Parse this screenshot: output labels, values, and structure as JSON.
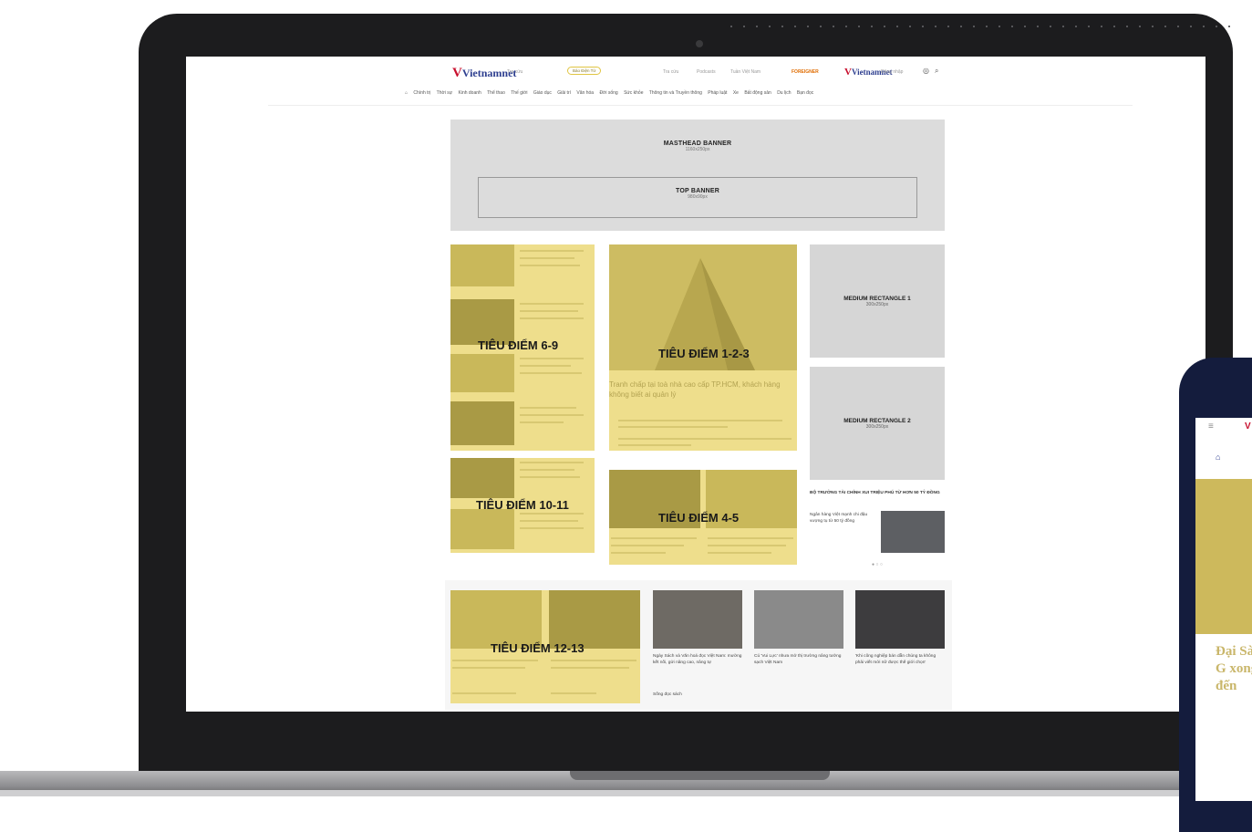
{
  "header": {
    "logo": "Vietnamnet",
    "links": [
      "Tra cứu",
      "Podcasts",
      "Tuần Việt Nam"
    ],
    "pill": "Báo Điện Tử",
    "featured": "FOREIGNER",
    "login": "Đăng nhập"
  },
  "nav": {
    "items": [
      "Chính trị",
      "Thời sự",
      "Kinh doanh",
      "Thể thao",
      "Thế giới",
      "Giáo dục",
      "Giải trí",
      "Văn hóa",
      "Đời sống",
      "Sức khỏe",
      "Thông tin và Truyền thông",
      "Pháp luật",
      "Xe",
      "Bất động sản",
      "Du lịch",
      "Bạn đọc"
    ]
  },
  "masthead": {
    "title": "MASTHEAD BANNER",
    "size": "1160x250px"
  },
  "top_banner": {
    "title": "TOP BANNER",
    "size": "980x90px"
  },
  "blocks": {
    "b69": "TIÊU ĐIỂM 6-9",
    "b123": "TIÊU ĐIỂM 1-2-3",
    "b1011": "TIÊU ĐIỂM 10-11",
    "b45": "TIÊU ĐIỂM 4-5",
    "b1213": "TIÊU ĐIỂM 12-13",
    "b123_headline": "Tranh chấp tại toà nhà cao cấp TP.HCM, khách hàng không biết ai quản lý"
  },
  "medium1": {
    "title": "MEDIUM RECTANGLE 1",
    "size": "300x250px"
  },
  "medium2": {
    "title": "MEDIUM RECTANGLE 2",
    "size": "300x250px"
  },
  "news": {
    "hot": "BỘ TRƯỞNG TÀI CHÍNH XUI TRIỆU PHÚ TỪ HƠN 50 TỶ ĐỒNG",
    "hot_sub": "Ngân hàng Việt mạnh chi đậu vượng tụ từ 50 tỷ đồng",
    "c1": "Ngày Sách và Văn hoá đọc Việt Nam: mường kết nối, gửi nâng cao, nâng tự",
    "c1_src": "Sống đọc sách",
    "c2": "Cú 'Vui Lực' nhưa mở thị trường nâng tưởng sạch Việt Nam",
    "c3": "'Khi công nghiệp bán dẫn chúng ta không phải viết mới nữ được thế giới chọn'"
  },
  "phone": {
    "headline": "Đại Sài G xong đến"
  },
  "colors": {
    "yellow": "#eede8c",
    "grey": "#dcdcdc",
    "navy": "#141c3d"
  }
}
